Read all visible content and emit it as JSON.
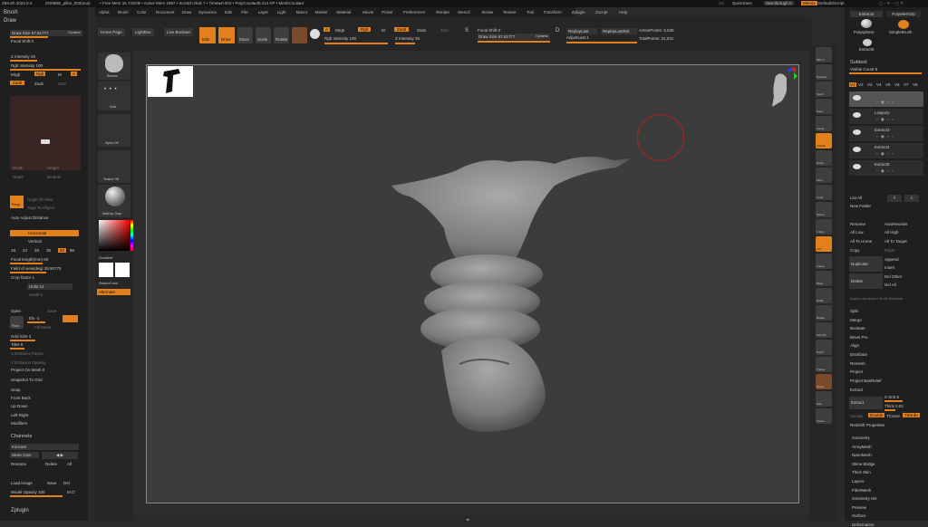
{
  "topbar": {
    "app": "ZBrush 2024.0.4",
    "project": "ZOMBIE_pillar_002(uca)",
    "mem": "• Free Mem 34.743GB • Active Mem 1897 • Scratch Disk 7 • Timer▸0.003 • PolyCount▸38.214 KP • MeshCount▸4",
    "ac": "AC",
    "quicksave": "QuickSave",
    "seethrough": "See-through 0",
    "menus": "Menus",
    "script": "DefaultZScript"
  },
  "menu": [
    "Alpha",
    "Brush",
    "Color",
    "Document",
    "Draw",
    "Dynamics",
    "Edit",
    "File",
    "Layer",
    "Light",
    "Macro",
    "Marker",
    "Material",
    "Movie",
    "Picker",
    "Preferences",
    "Render",
    "Stencil",
    "Stroke",
    "Texture",
    "Tool",
    "Transform",
    "Zplugin",
    "Zscript",
    "Help"
  ],
  "coords": "0.182,0.474,-1.186",
  "toolbar": {
    "home": "Home Page",
    "lightbox": "LightBox",
    "live": "Live Boolean",
    "edit": "Edit",
    "draw": "Draw",
    "move": "Move",
    "scale": "Scale",
    "rotate": "Rotate",
    "a": "A",
    "mrgb": "Mrgb",
    "rgb": "Rgb",
    "m": "M",
    "rgbint": "Rgb Intensity 100",
    "zadd": "Zadd",
    "zsub": "Zsub",
    "zcut": "Zcut",
    "zint": "Z Intensity 26",
    "s": "S",
    "focal": "Focal Shift 0",
    "drawsize": "Draw Size 67.61777",
    "dynamic": "Dynamic",
    "d": "D",
    "replaylast": "ReplayLast",
    "replaylastrel": "ReplayLastRel",
    "adjustlast": "AdjustLast 1",
    "activepoints": "ActivePoints: 4,536",
    "totalpoints": "TotalPoints: 31,031"
  },
  "left": {
    "brush": "Brush",
    "draw": "Draw",
    "drawsize": "Draw Size 67.61777",
    "dynamic": "Dynamic",
    "focal": "Focal Shift 0",
    "zint": "Z Intensity 26",
    "rgbint": "Rgb Intensity 100",
    "mrgb": "Mrgb",
    "rgb": "Rgb",
    "m": "M",
    "a": "A",
    "zadd": "Zadd",
    "zsub": "Zsub",
    "zcut": "Zcut",
    "width": "Width",
    "height": "Height",
    "depth": "Depth",
    "embed": "Embed",
    "persp": "Persp",
    "angleview": "Angle Of View",
    "alignobj": "Align To Object",
    "autoadj": "Auto Adjust Distance",
    "horizontal": "Horizontal",
    "vertical": "Vertical",
    "nums": [
      "18",
      "24",
      "28",
      "35",
      "50",
      "85"
    ],
    "focallen": "Focal length(mm) 50",
    "fov": "Field of view(deg) 39.50775",
    "crop": "Crop factor 1",
    "units": "Units 14",
    "scale": "Scale 0",
    "open": "Open",
    "save": "Save",
    "floor": "Floor",
    "elv": "Elv -1",
    "fill": "Fill",
    "fillmode": "Fill Mode",
    "gridsize": "Grid Size 3",
    "tiles": "Tiles 8",
    "xenh": "X Enhance Factor",
    "yenh": "Y Enhance Opacity",
    "projmesh": "Project On Mesh 0",
    "snapgrid": "Snapshot To Grid",
    "snap": "Snap",
    "frontback": "Front Back",
    "updown": "Up Down",
    "leftright": "Left Right",
    "modifiers": "Modifiers",
    "channels": "Channels",
    "ironcam": "Ironcam",
    "storecam": "Store Cam",
    "rename": "Rename",
    "delete": "Delete",
    "all": "All",
    "loadimg": "Load Image",
    "save2": "Save",
    "del": "Del",
    "modelop": "Model Opacity 100",
    "mo": "M O",
    "zplugin": "Zplugin"
  },
  "shelf": {
    "brush": "Restore",
    "dots": "Dots",
    "alpha": "Alpha Off",
    "texture": "Texture Off",
    "matcap": "MatCap Gray",
    "gradient": "Gradient",
    "switch": "SwitchColor",
    "alternate": "Alternate"
  },
  "rshelf": [
    "SPix 3",
    "Dynamic",
    "Scroll",
    "Zoom",
    "Actual",
    "AAHalf",
    "Persp",
    "Floor",
    "Local",
    "Gizmo",
    "L.Sym",
    "Xyz",
    "Frame",
    "Move",
    "Scale",
    "Rotate",
    "Line Fill",
    "PolyF",
    "Transp",
    "Ghost",
    "Solo",
    "Xpose"
  ],
  "right": {
    "extract": "Extract4",
    "polymesh": "PolyMesh3D",
    "polysphere": "Polysphere",
    "simplebrush": "SimpleBrush",
    "extract5": "Extract5",
    "subtool": "Subtool",
    "visible": "Visible Count 8",
    "tabs": [
      "V1",
      "V2",
      "V3",
      "V4",
      "V5",
      "V6",
      "V7",
      "V8"
    ],
    "items": [
      "",
      "Lowpoly",
      "Extract3",
      "Extract4",
      "Extract5"
    ],
    "listall": "List All",
    "newfolder": "New Folder",
    "rename": "Rename",
    "autoreorder": "AutoReorder",
    "alllow": "All Low",
    "allhigh": "All High",
    "alltohome": "All To Home",
    "alltotarget": "All To Target",
    "copy": "Copy",
    "paste": "Paste",
    "duplicate": "Duplicate",
    "append": "Append",
    "insert": "Insert",
    "delete": "Delete",
    "delother": "Del Other",
    "delall": "Del All",
    "applylast": "Apply Last Action To All Subtools",
    "split": "Split",
    "merge": "Merge",
    "boolean": "Boolean",
    "bevelpro": "Bevel Pro",
    "align": "Align",
    "distribute": "Distribute",
    "remesh": "Remesh",
    "project": "Project",
    "projectbas": "Project BasRelief",
    "extractsec": "Extract",
    "smt": "S Smt 5",
    "thick": "Thick 0.02",
    "extractbtn": "Extract",
    "accept": "Accept",
    "double": "Double",
    "tcorner": "TCorne",
    "tborder": "TBorde",
    "redshift": "Redshift Properties",
    "sub": [
      "Geometry",
      "ArrayMesh",
      "NanoMesh",
      "Slime Bridge",
      "Thick Skin",
      "Layers",
      "FiberMesh",
      "Geometry HD",
      "Preview",
      "Surface",
      "Deformation"
    ]
  },
  "colors": {
    "accent": "#e2801e",
    "bg": "#2a2a2a",
    "viewport": "#3c3c3c"
  }
}
